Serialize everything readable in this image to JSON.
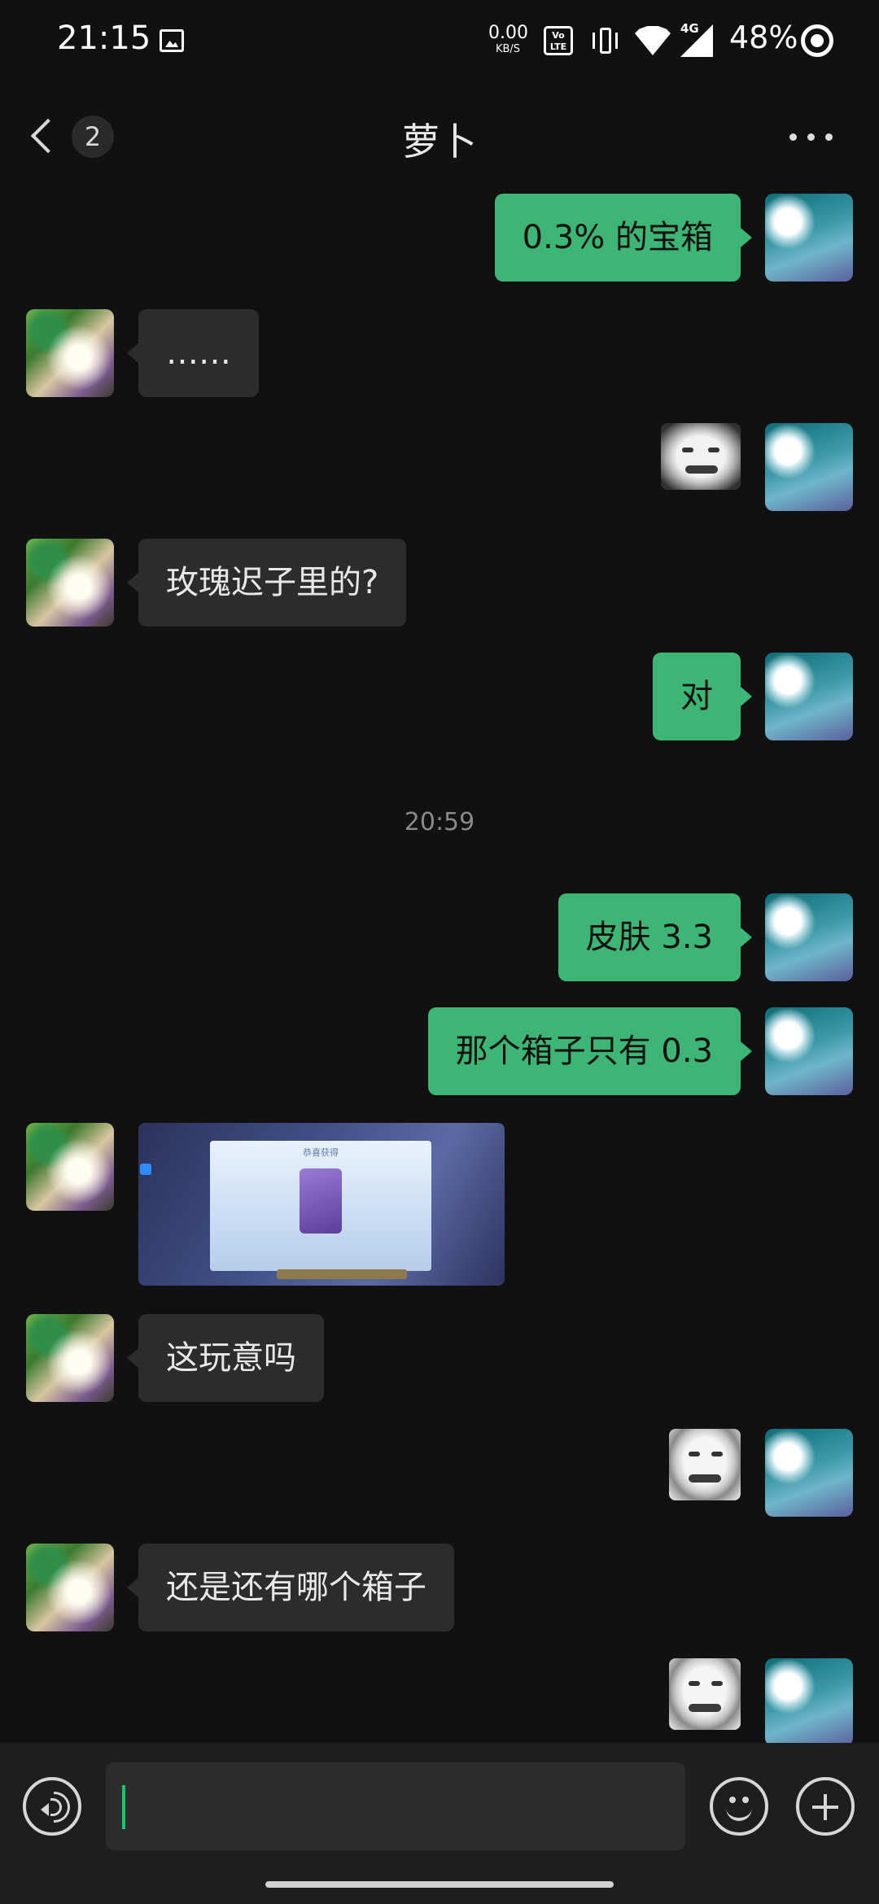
{
  "status_bar": {
    "time": "21:15",
    "net_speed": "0.00",
    "net_unit": "KB/S",
    "volte": "Vo LTE",
    "network": "4G",
    "battery": "48%"
  },
  "header": {
    "unread_count": "2",
    "title": "萝卜"
  },
  "messages": [
    {
      "from": "me",
      "type": "text",
      "text": "0.3% 的宝箱"
    },
    {
      "from": "them",
      "type": "text",
      "text": "……"
    },
    {
      "from": "me",
      "type": "sticker",
      "icon": "grinning-face-sticker"
    },
    {
      "from": "them",
      "type": "text",
      "text": "玫瑰迟子里的?"
    },
    {
      "from": "me",
      "type": "text",
      "text": "对"
    },
    {
      "from": "system",
      "type": "timestamp",
      "text": "20:59"
    },
    {
      "from": "me",
      "type": "text",
      "text": "皮肤 3.3"
    },
    {
      "from": "me",
      "type": "text",
      "text": "那个箱子只有 0.3"
    },
    {
      "from": "them",
      "type": "image",
      "caption": "恭喜获得"
    },
    {
      "from": "them",
      "type": "text",
      "text": "这玩意吗"
    },
    {
      "from": "me",
      "type": "sticker",
      "icon": "crying-face-sticker"
    },
    {
      "from": "them",
      "type": "text",
      "text": "还是还有哪个箱子"
    },
    {
      "from": "me",
      "type": "sticker",
      "icon": "crying-face-sticker"
    }
  ],
  "input_bar": {
    "text_value": "",
    "accent_color": "#19c56c"
  },
  "colors": {
    "my_bubble": "#3db574",
    "their_bubble": "#2c2c2c",
    "background": "#111111"
  }
}
